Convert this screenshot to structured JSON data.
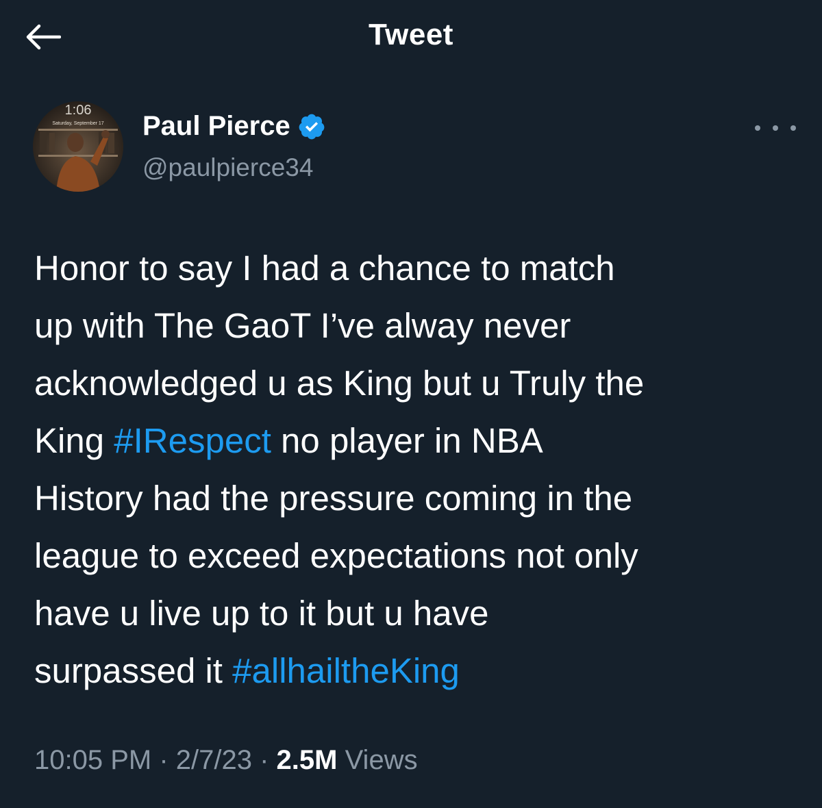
{
  "header": {
    "title": "Tweet",
    "back_icon": "arrow-left-icon"
  },
  "author": {
    "display_name": "Paul Pierce",
    "handle": "@paulpierce34",
    "verified": true,
    "verified_color": "#1d9bf0",
    "avatar_time": "1:06",
    "avatar_date": "Saturday, September 17"
  },
  "tweet": {
    "lines": [
      [
        {
          "text": "Honor to say I had a chance to match"
        }
      ],
      [
        {
          "text": "up with The GaoT I’ve alway never"
        }
      ],
      [
        {
          "text": "acknowledged u as King but u Truly the"
        }
      ],
      [
        {
          "text": "King "
        },
        {
          "text": "#IRespect",
          "hashtag": true
        },
        {
          "text": " no player in NBA"
        }
      ],
      [
        {
          "text": "History had the pressure coming in the"
        }
      ],
      [
        {
          "text": "league to exceed expectations not only"
        }
      ],
      [
        {
          "text": "have u live up to it but u have"
        }
      ],
      [
        {
          "text": "surpassed it "
        },
        {
          "text": "#allhailtheKing",
          "hashtag": true
        }
      ]
    ]
  },
  "meta": {
    "time": "10:05 PM",
    "separator": " · ",
    "date": "2/7/23",
    "views_count": "2.5M",
    "views_label": "Views"
  },
  "colors": {
    "background": "#15202b",
    "text": "#ffffff",
    "secondary": "#8b98a5",
    "accent": "#1d9bf0"
  }
}
